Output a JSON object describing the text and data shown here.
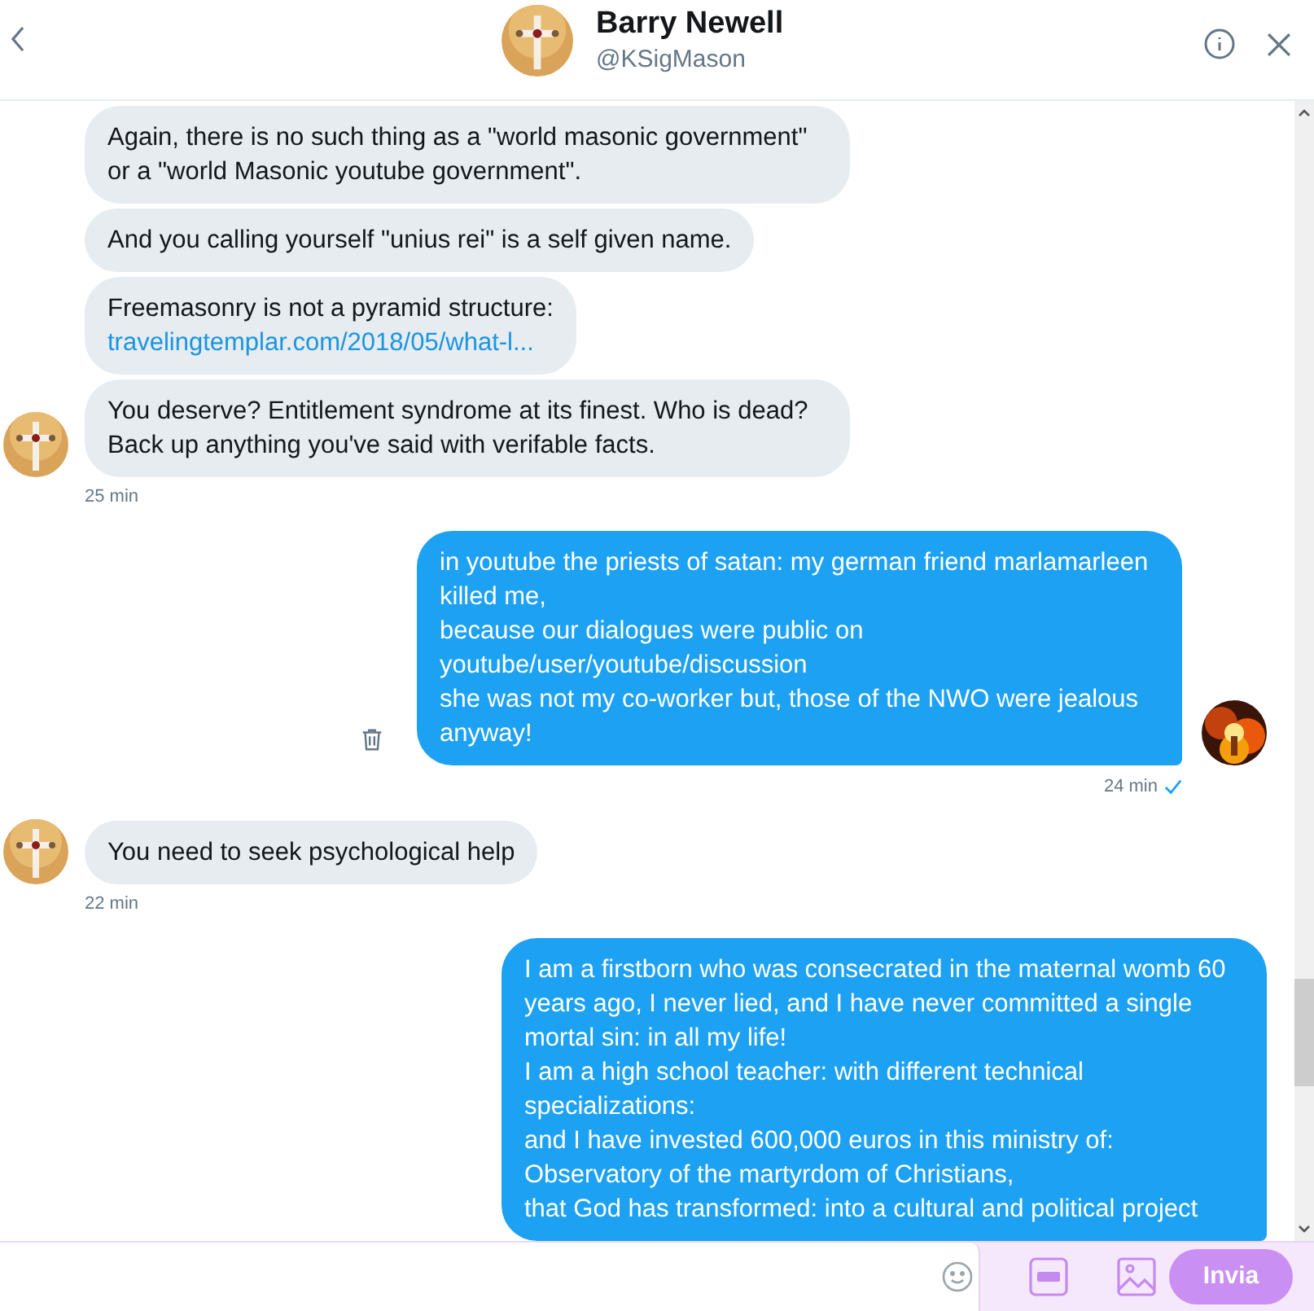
{
  "header": {
    "name": "Barry Newell",
    "handle": "@KSigMason"
  },
  "messages": [
    {
      "kind": "received",
      "bubbles": [
        {
          "text": "Again, there is no such thing as a \"world masonic government\" or a \"world Masonic youtube government\"."
        },
        {
          "text": "And you calling yourself \"unius rei\" is a self given name."
        },
        {
          "text": "Freemasonry is not a pyramid structure:",
          "link": "travelingtemplar.com/2018/05/what-l..."
        },
        {
          "text": "You deserve? Entitlement syndrome at its finest. Who is dead? Back up anything you've said with verifable facts."
        }
      ],
      "time": "25 min"
    },
    {
      "kind": "sent",
      "bubbles": [
        {
          "text": "in youtube the priests of satan: my german friend marlamarleen killed me,\nbecause our dialogues were public on youtube/user/youtube/discussion\nshe was not my co-worker but, those of the NWO were jealous anyway!"
        }
      ],
      "time": "24 min",
      "seen": true
    },
    {
      "kind": "received",
      "bubbles": [
        {
          "text": "You need to seek psychological help"
        }
      ],
      "time": "22 min"
    },
    {
      "kind": "sent",
      "bubbles": [
        {
          "text": "I am a firstborn who was consecrated in the maternal womb 60 years ago, I never lied, and I have never committed a single mortal sin: in all my life!\nI am a high school teacher: with different technical specializations:\nand I have invested 600,000 euros in this ministry of:\nObservatory of the martyrdom of Christians,\nthat God has transformed: into a cultural and political project"
        }
      ]
    }
  ],
  "composer": {
    "send_label": "Invia",
    "send_disabled": true
  }
}
